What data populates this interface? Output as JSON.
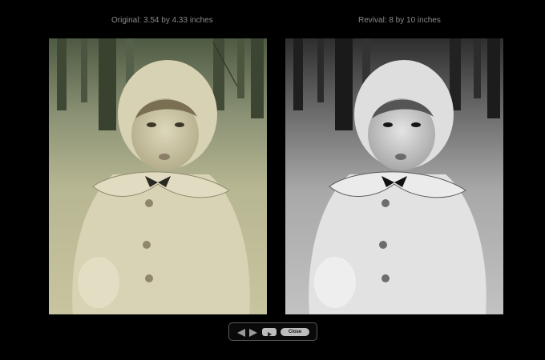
{
  "captions": {
    "original": "Original: 3.54 by 4.33 inches",
    "revival": "Revival: 8 by 10 inches"
  },
  "controls": {
    "close_label": "Close",
    "prev_icon": "triangle-left-icon",
    "next_icon": "triangle-right-icon",
    "play_icon": "play-icon"
  },
  "colors": {
    "background": "#000000",
    "caption": "#8a8a8a",
    "button": "#bdbdbd",
    "sepia_tint": "#cfc9a6"
  }
}
